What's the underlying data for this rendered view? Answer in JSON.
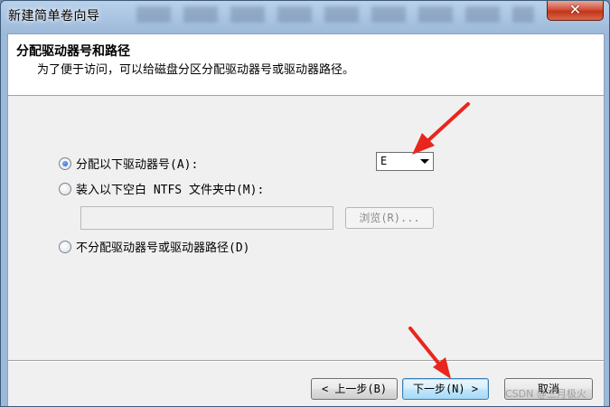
{
  "window": {
    "title": "新建简单卷向导",
    "close_glyph": "✕"
  },
  "header": {
    "title": "分配驱动器号和路径",
    "subtitle": "为了便于访问，可以给磁盘分区分配驱动器号或驱动器路径。"
  },
  "options": {
    "assign_letter": {
      "label": "分配以下驱动器号(A):",
      "checked": true
    },
    "mount_folder": {
      "label": "装入以下空白 NTFS 文件夹中(M):",
      "checked": false
    },
    "no_assign": {
      "label": "不分配驱动器号或驱动器路径(D)",
      "checked": false
    }
  },
  "drive_letter": {
    "selected": "E"
  },
  "folder_path": {
    "value": ""
  },
  "browse_button": {
    "label": "浏览(R)..."
  },
  "footer": {
    "back_label": "< 上一步(B)",
    "next_label": "下一步(N) >",
    "cancel_label": "取消"
  },
  "watermark": {
    "text": "CSDN @三月极火"
  },
  "colors": {
    "annotation_arrow": "#e8261e",
    "close_button": "#c8422a",
    "default_button_border": "#3c7fb1"
  }
}
